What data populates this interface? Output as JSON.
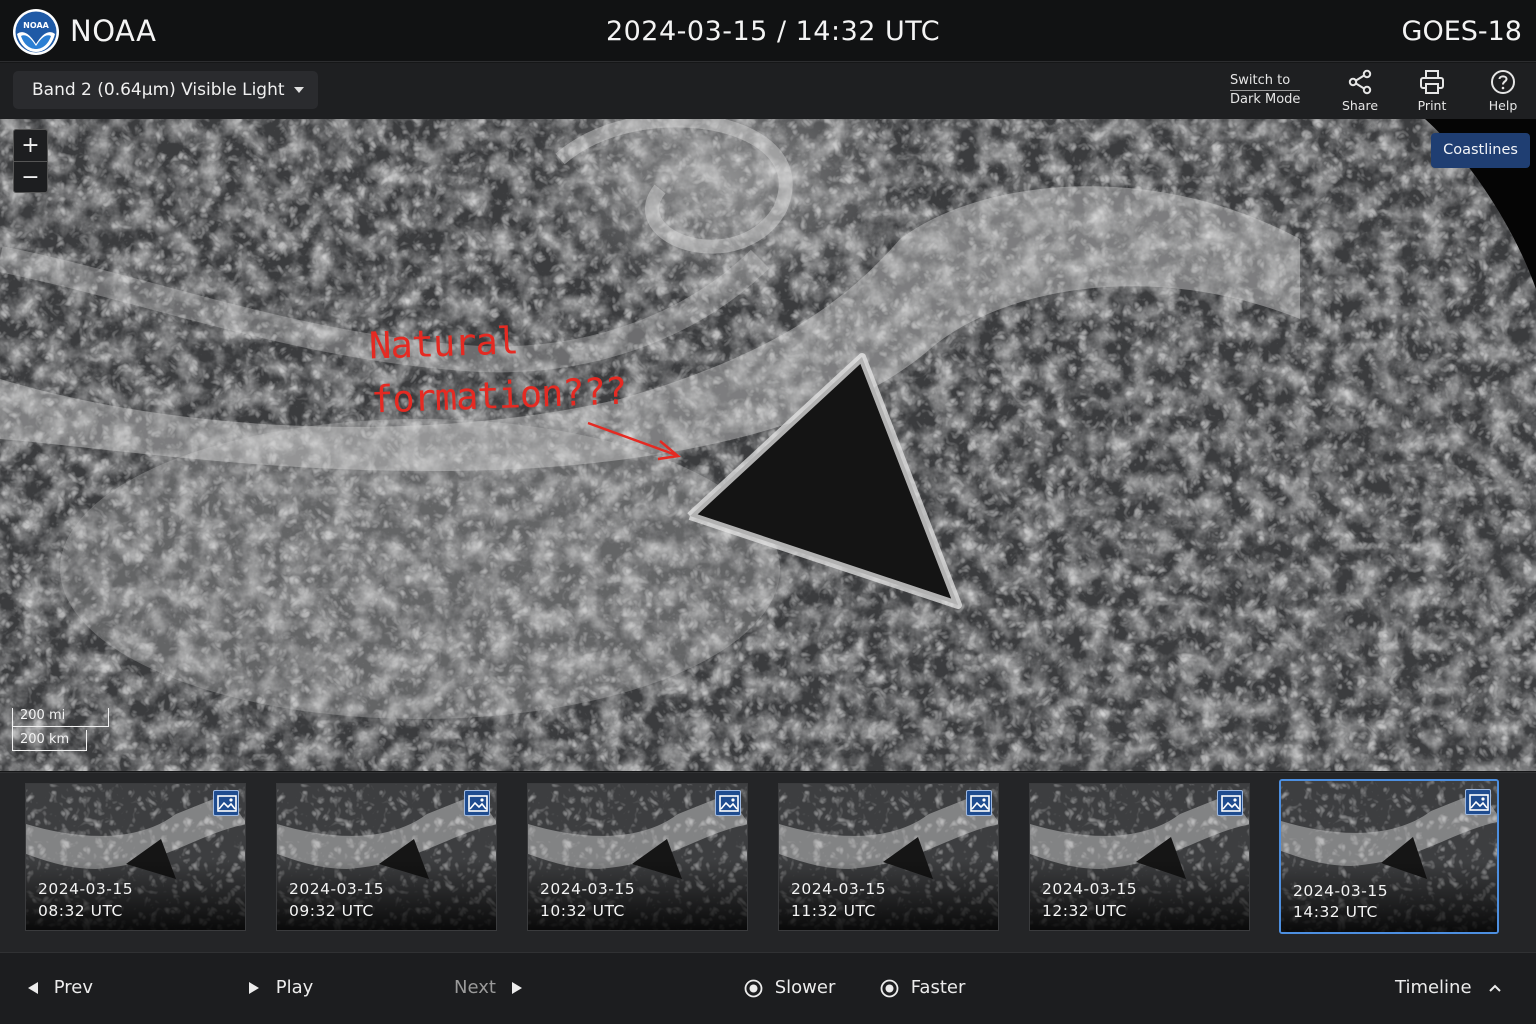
{
  "header": {
    "brand": "NOAA",
    "logo_text": "NOAA",
    "datetime": "2024-03-15 / 14:32 UTC",
    "satellite": "GOES-18"
  },
  "toolbar": {
    "band_selected": "Band 2 (0.64μm) Visible Light",
    "dark_mode_line1": "Switch to",
    "dark_mode_line2": "Dark Mode",
    "share_label": "Share",
    "print_label": "Print",
    "help_label": "Help"
  },
  "map": {
    "zoom_in": "+",
    "zoom_out": "−",
    "coastlines_label": "Coastlines",
    "scale_miles": "200 mi",
    "scale_km": "200 km",
    "annotation_line1": "Natural",
    "annotation_line2": "formation???",
    "annotation_color": "#e52a22"
  },
  "timeline": {
    "frames": [
      {
        "date": "2024-03-15",
        "time": "08:32 UTC"
      },
      {
        "date": "2024-03-15",
        "time": "09:32 UTC"
      },
      {
        "date": "2024-03-15",
        "time": "10:32 UTC"
      },
      {
        "date": "2024-03-15",
        "time": "11:32 UTC"
      },
      {
        "date": "2024-03-15",
        "time": "12:32 UTC"
      },
      {
        "date": "2024-03-15",
        "time": "14:32 UTC"
      }
    ],
    "active_frame": 5,
    "active_color": "#4d8fe0"
  },
  "controls": {
    "prev": "Prev",
    "play": "Play",
    "next": "Next",
    "slower": "Slower",
    "faster": "Faster",
    "timeline": "Timeline"
  },
  "icons": {
    "logo": "noaa-logo-icon",
    "share": "share-icon",
    "print": "printer-icon",
    "help": "help-icon",
    "thumbnail": "image-icon"
  }
}
